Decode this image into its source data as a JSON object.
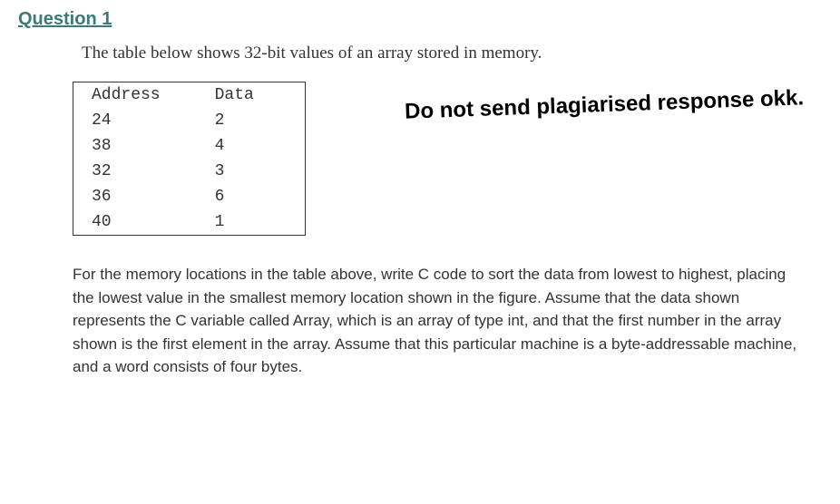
{
  "question": {
    "header": "Question 1",
    "intro": "The table below shows 32-bit values of an array stored in memory.",
    "table": {
      "headers": [
        "Address",
        "Data"
      ],
      "rows": [
        [
          "24",
          "2"
        ],
        [
          "38",
          "4"
        ],
        [
          "32",
          "3"
        ],
        [
          "36",
          "6"
        ],
        [
          "40",
          "1"
        ]
      ]
    },
    "warning": "Do not send plagiarised response okk.",
    "paragraph": "For the memory locations in the table above, write C code to sort the data from lowest to highest, placing the lowest value in the smallest memory location shown in the figure. Assume that the data shown represents the C variable called Array, which is an array of type int, and that the first number in the array shown is the first element in the array. Assume that this particular machine is a byte-addressable machine, and a word consists of four bytes."
  }
}
